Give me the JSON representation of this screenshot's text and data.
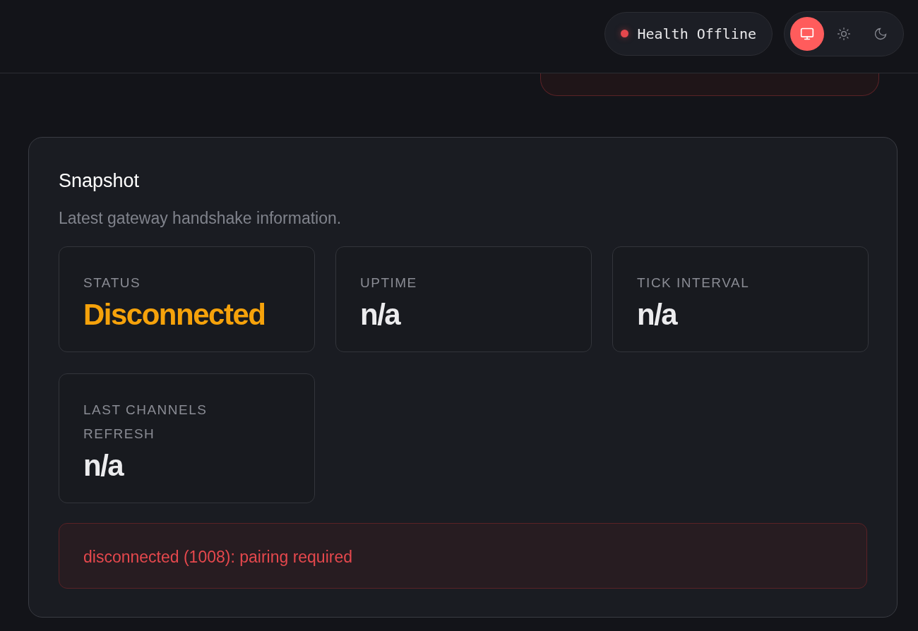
{
  "header": {
    "health": {
      "label": "Health Offline",
      "online": false
    },
    "theme_options": [
      {
        "kind": "system",
        "selected": true
      },
      {
        "kind": "light",
        "selected": false
      },
      {
        "kind": "dark",
        "selected": false
      }
    ]
  },
  "snapshot": {
    "title": "Snapshot",
    "subtitle": "Latest gateway handshake information.",
    "stats": [
      {
        "label": "STATUS",
        "value": "Disconnected",
        "warning": true
      },
      {
        "label": "UPTIME",
        "value": "n/a",
        "warning": false
      },
      {
        "label": "TICK INTERVAL",
        "value": "n/a",
        "warning": false
      },
      {
        "label": "LAST CHANNELS REFRESH",
        "value": "n/a",
        "warning": false
      }
    ],
    "error": "disconnected (1008): pairing required"
  }
}
